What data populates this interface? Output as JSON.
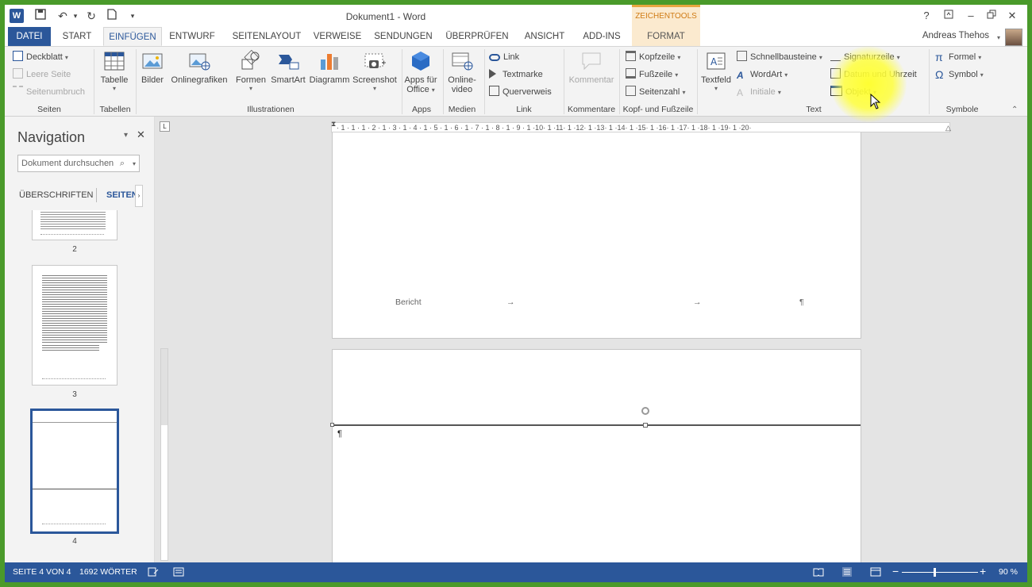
{
  "app": {
    "title": "Dokument1 - Word",
    "context_tools": "ZEICHENTOOLS",
    "user": "Andreas Thehos",
    "help": "?"
  },
  "tabs": [
    "DATEI",
    "START",
    "EINFÜGEN",
    "ENTWURF",
    "SEITENLAYOUT",
    "VERWEISE",
    "SENDUNGEN",
    "ÜBERPRÜFEN",
    "ANSICHT",
    "ADD-INS",
    "FORMAT"
  ],
  "ribbon": {
    "seiten": {
      "label": "Seiten",
      "items": [
        "Deckblatt",
        "Leere Seite",
        "Seitenumbruch"
      ]
    },
    "tabellen": {
      "label": "Tabellen",
      "tabelle": "Tabelle"
    },
    "illustrationen": {
      "label": "Illustrationen",
      "items": [
        "Bilder",
        "Onlinegrafiken",
        "Formen",
        "SmartArt",
        "Diagramm",
        "Screenshot"
      ]
    },
    "apps": {
      "label": "Apps",
      "line1": "Apps für",
      "line2": "Office"
    },
    "medien": {
      "label": "Medien",
      "line1": "Online-",
      "line2": "video"
    },
    "link": {
      "label": "Link",
      "items": [
        "Link",
        "Textmarke",
        "Querverweis"
      ]
    },
    "kommentare": {
      "label": "Kommentare",
      "kommentar": "Kommentar"
    },
    "kopf": {
      "label": "Kopf- und Fußzeile",
      "items": [
        "Kopfzeile",
        "Fußzeile",
        "Seitenzahl"
      ]
    },
    "text": {
      "label": "Text",
      "textfeld": "Textfeld",
      "col1": [
        "Schnellbausteine",
        "WordArt",
        "Initiale"
      ],
      "col2": [
        "Signaturzeile",
        "Datum und Uhrzeit",
        "Objekt"
      ]
    },
    "symbole": {
      "label": "Symbole",
      "items": [
        "Formel",
        "Symbol"
      ]
    }
  },
  "navigation": {
    "title": "Navigation",
    "search_placeholder": "Dokument durchsuchen",
    "tabs": [
      "ÜBERSCHRIFTEN",
      "SEITEN"
    ],
    "pages": [
      "2",
      "3",
      "4"
    ]
  },
  "document": {
    "footer_text": "Bericht",
    "tab_arrow": "→",
    "pilcrow": "¶",
    "ruler_numbers": "· 1 · 1 · 1 · 2 · 1 · 3 · 1 · 4 · 1 · 5 · 1 · 6 · 1 · 7 · 1 · 8 · 1 · 9 · 1 ·10· 1 ·11· 1 ·12· 1 ·13· 1 ·14· 1 ·15· 1 ·16· 1 ·17· 1 ·18· 1 ·19· 1 ·20·"
  },
  "status": {
    "page": "SEITE 4 VON 4",
    "words": "1692 WÖRTER",
    "zoom": "90 %"
  },
  "colors": {
    "accent": "#2b579a",
    "context": "#e8a640",
    "frame": "#4a9a2a"
  }
}
